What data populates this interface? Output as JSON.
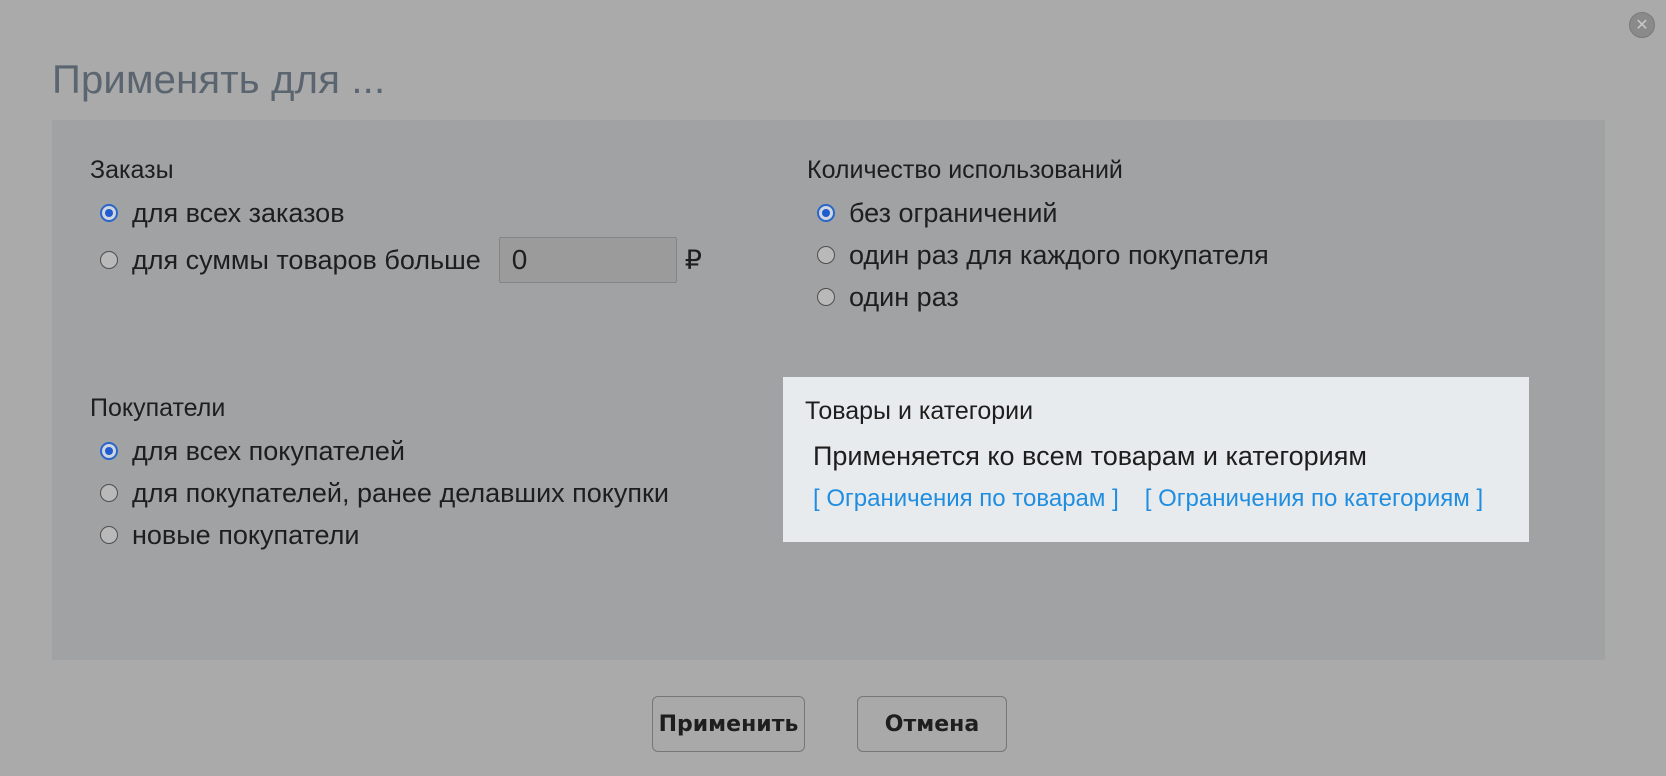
{
  "dialog": {
    "title": "Применять для ...",
    "close_icon": "close-icon"
  },
  "orders": {
    "title": "Заказы",
    "options": [
      {
        "label": "для всех заказов",
        "checked": true
      },
      {
        "label": "для суммы товаров больше",
        "checked": false
      }
    ],
    "amount_value": "0",
    "currency": "₽"
  },
  "usage": {
    "title": "Количество использований",
    "options": [
      {
        "label": "без ограничений",
        "checked": true
      },
      {
        "label": "один раз для каждого покупателя",
        "checked": false
      },
      {
        "label": "один раз",
        "checked": false
      }
    ]
  },
  "customers": {
    "title": "Покупатели",
    "options": [
      {
        "label": "для всех покупателей",
        "checked": true
      },
      {
        "label": "для покупателей, ранее делавших покупки",
        "checked": false
      },
      {
        "label": "новые покупатели",
        "checked": false
      }
    ]
  },
  "products": {
    "title": "Товары и категории",
    "summary": "Применяется ко всем товарам и категориям",
    "links": [
      "[ Ограничения по товарам ]",
      "[ Ограничения по категориям ]"
    ]
  },
  "buttons": {
    "apply": "Применить",
    "cancel": "Отмена"
  },
  "colors": {
    "overlay": "#aaaaaa",
    "panel": "#a1a2a4",
    "highlight_box": "#e8ebee",
    "link": "#1f8ee0",
    "radio_checked": "#1e5ccf"
  }
}
